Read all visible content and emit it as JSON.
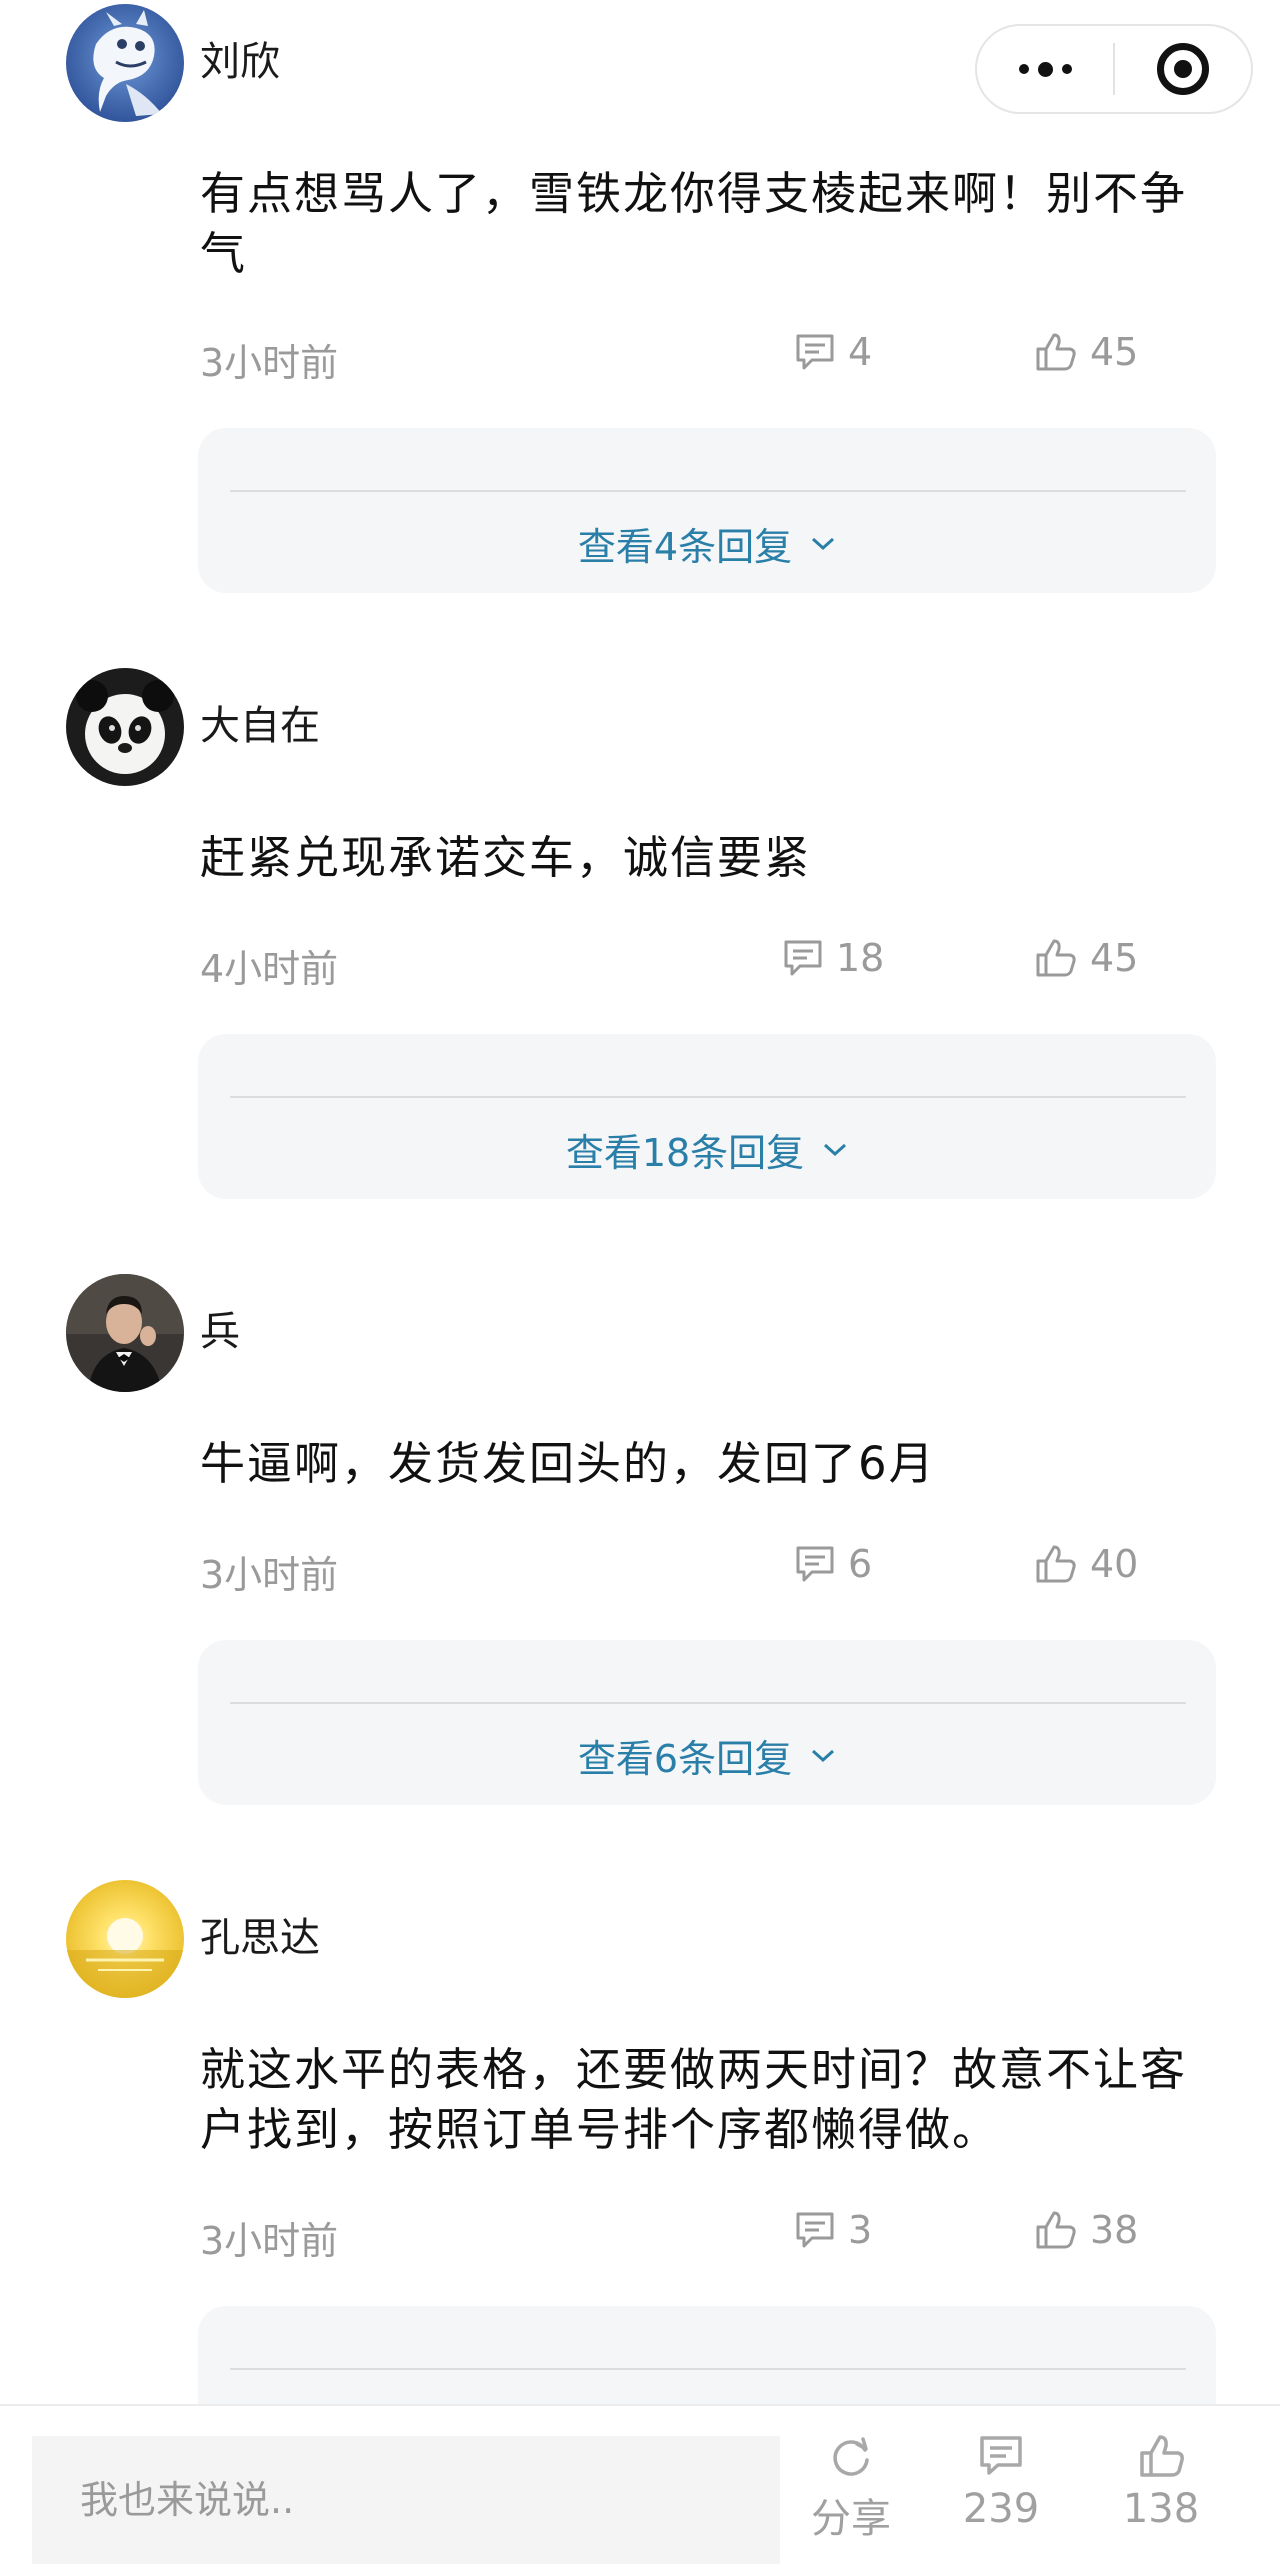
{
  "capsule": {
    "more_icon": "more-dots-icon",
    "close_icon": "target-circle-icon"
  },
  "comments": [
    {
      "username": "刘欣",
      "avatar": "dragon-illustration",
      "text": "有点想骂人了，雪铁龙你得支棱起来啊！别不争气",
      "time": "3小时前",
      "reply_count": "4",
      "like_count": "45",
      "view_replies": "查看4条回复"
    },
    {
      "username": "大自在",
      "avatar": "panda-photo",
      "text": "赶紧兑现承诺交车，诚信要紧",
      "time": "4小时前",
      "reply_count": "18",
      "like_count": "45",
      "view_replies": "查看18条回复"
    },
    {
      "username": "兵",
      "avatar": "man-in-tuxedo-photo",
      "text": "牛逼啊，发货发回头的，发回了6月",
      "time": "3小时前",
      "reply_count": "6",
      "like_count": "40",
      "view_replies": "查看6条回复"
    },
    {
      "username": "孔思达",
      "avatar": "sunset-photo",
      "text": "就这水平的表格，还要做两天时间？故意不让客户找到，按照订单号排个序都懒得做。",
      "time": "3小时前",
      "reply_count": "3",
      "like_count": "38"
    }
  ],
  "bottombar": {
    "input_placeholder": "我也来说说..",
    "share_label": "分享",
    "comment_count": "239",
    "like_count": "138"
  },
  "colors": {
    "link": "#2a7fa8",
    "muted": "#9a9a9a",
    "reply_bg": "#f5f6f8"
  }
}
